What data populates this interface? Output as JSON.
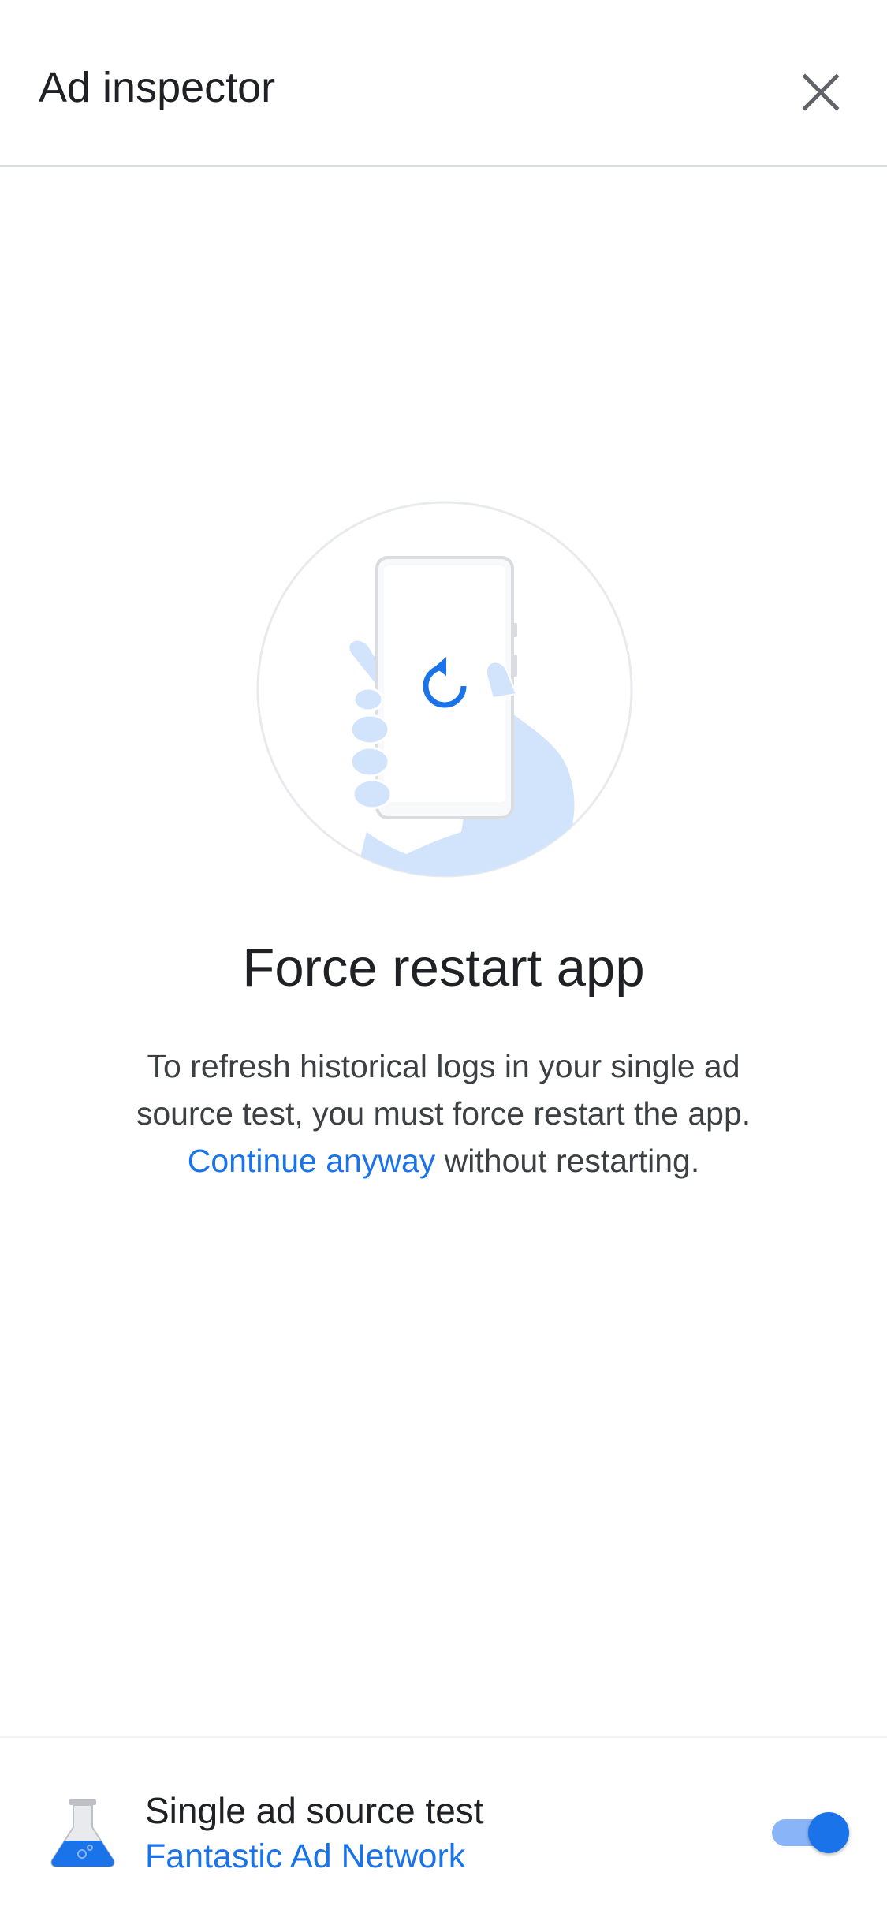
{
  "app_bar": {
    "title": "Ad inspector",
    "close_icon": "close-icon"
  },
  "main": {
    "illustration_icon": "hand-holding-phone-restart-icon",
    "heading": "Force restart app",
    "description_line1": "To refresh historical logs in your single ad",
    "description_line2": "source test, you must force restart the app.",
    "link_text": "Continue anyway",
    "description_line3_rest": " without restarting."
  },
  "bottom_bar": {
    "icon": "flask-icon",
    "title": "Single ad source test",
    "subtitle": "Fantastic Ad Network",
    "toggle_on": true
  },
  "colors": {
    "accent": "#1a73e8",
    "accent_light": "#8ab4f8",
    "hand": "#d2e3fc",
    "text_primary": "#202124",
    "text_secondary": "#3c4043",
    "divider": "#dadce0"
  }
}
